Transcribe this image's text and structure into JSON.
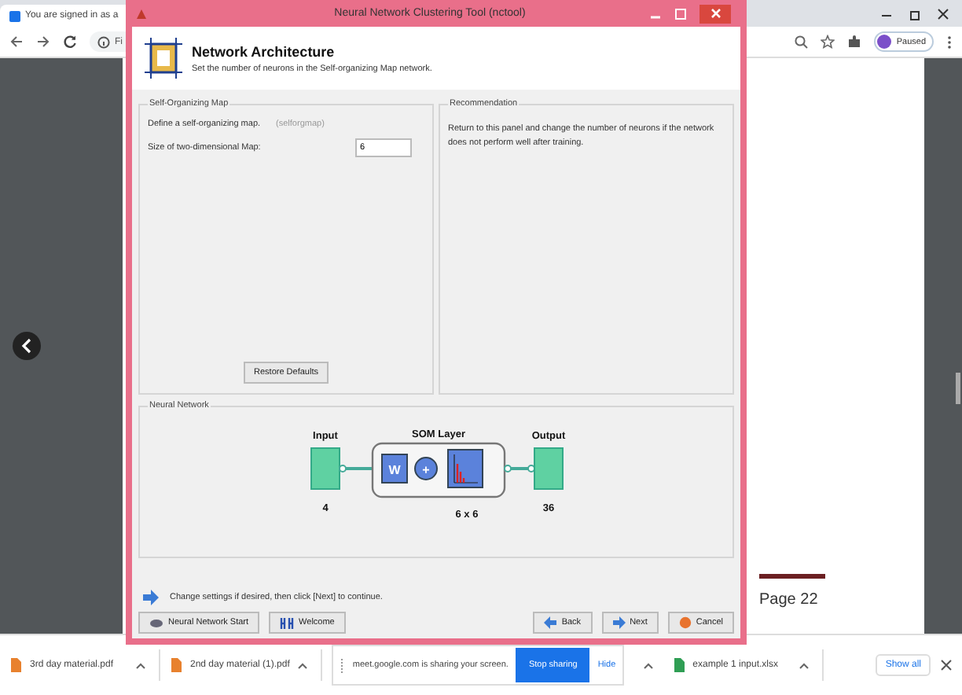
{
  "browser": {
    "tab_title": "You are signed in as a",
    "address": "Fi",
    "profile_label": "Paused"
  },
  "document": {
    "page_number": "Page 22"
  },
  "dialog": {
    "title": "Neural Network Clustering Tool (nctool)",
    "header": {
      "title": "Network Architecture",
      "subtitle": "Set the number of neurons in the Self-organizing Map network."
    },
    "som_panel": {
      "legend": "Self-Organizing Map",
      "define_label": "Define a self-organizing map.",
      "define_function": "(selforgmap)",
      "size_label": "Size of two-dimensional Map:",
      "size_value": "6",
      "restore_button": "Restore Defaults"
    },
    "recommendation": {
      "legend": "Recommendation",
      "text": "Return to this panel and change the number of neurons if the network does not perform well after training."
    },
    "network": {
      "legend": "Neural Network",
      "input_label": "Input",
      "input_size": "4",
      "layer_label": "SOM Layer",
      "weight_label": "W",
      "sum_label": "+",
      "layer_size": "6 x 6",
      "output_label": "Output",
      "output_size": "36"
    },
    "instruction": "Change settings if desired, then click [Next] to continue.",
    "buttons_left": [
      {
        "label": "Neural Network Start",
        "kind": "start"
      },
      {
        "label": "Welcome",
        "kind": "welcome"
      }
    ],
    "buttons_right": [
      {
        "label": "Back",
        "kind": "back"
      },
      {
        "label": "Next",
        "kind": "next"
      },
      {
        "label": "Cancel",
        "kind": "cancel"
      }
    ]
  },
  "downloads": [
    {
      "name": "3rd day material.pdf",
      "kind": "pdf"
    },
    {
      "name": "2nd day material (1).pdf",
      "kind": "pdf"
    }
  ],
  "share_bar": {
    "text": "meet.google.com is sharing your screen.",
    "stop_button": "Stop sharing",
    "hide_link": "Hide"
  },
  "downloads_after": [
    {
      "name": "example 1 input.xlsx",
      "kind": "xlsx"
    }
  ],
  "show_all": "Show all"
}
